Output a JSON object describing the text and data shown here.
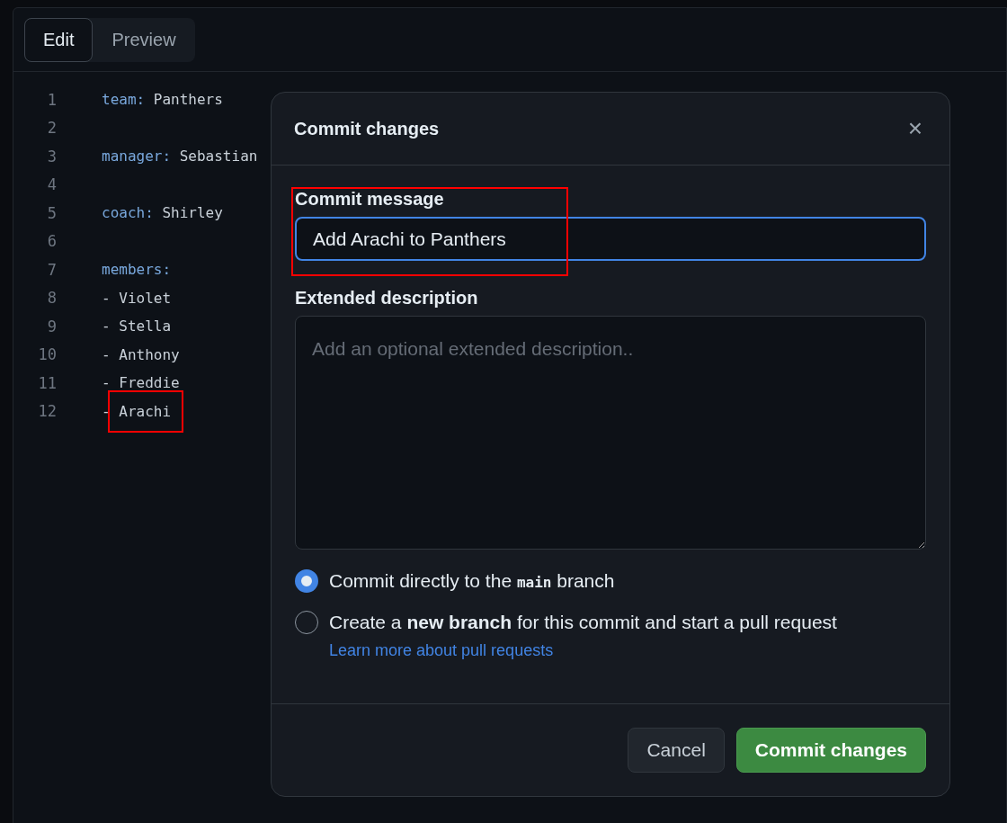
{
  "editor": {
    "tabs": [
      {
        "label": "Edit",
        "selected": true
      },
      {
        "label": "Preview",
        "selected": false
      }
    ],
    "lines": [
      {
        "number": "1",
        "kind": "pair",
        "key": "team:",
        "value": "Panthers",
        "highlighted": false
      },
      {
        "number": "2",
        "kind": "blank",
        "highlighted": false
      },
      {
        "number": "3",
        "kind": "pair",
        "key": "manager:",
        "value": "Sebastian",
        "highlighted": false
      },
      {
        "number": "4",
        "kind": "blank",
        "highlighted": false
      },
      {
        "number": "5",
        "kind": "pair",
        "key": "coach:",
        "value": "Shirley",
        "highlighted": false
      },
      {
        "number": "6",
        "kind": "blank",
        "highlighted": false
      },
      {
        "number": "7",
        "kind": "key",
        "key": "members:",
        "highlighted": false
      },
      {
        "number": "8",
        "kind": "item",
        "dash": "-",
        "value": "Violet",
        "highlighted": false
      },
      {
        "number": "9",
        "kind": "item",
        "dash": "-",
        "value": "Stella",
        "highlighted": false
      },
      {
        "number": "10",
        "kind": "item",
        "dash": "-",
        "value": "Anthony",
        "highlighted": false
      },
      {
        "number": "11",
        "kind": "item",
        "dash": "-",
        "value": "Freddie",
        "highlighted": false
      },
      {
        "number": "12",
        "kind": "item",
        "dash": "-",
        "value": "Arachi",
        "highlighted": true
      }
    ]
  },
  "dialog": {
    "title": "Commit changes",
    "close": "×",
    "commit_message": {
      "label": "Commit message",
      "value": "Add Arachi to Panthers",
      "focused": true,
      "highlighted": true
    },
    "extended_description": {
      "label": "Extended description",
      "placeholder": "Add an optional extended description.."
    },
    "options": [
      {
        "selected": true,
        "parts": [
          {
            "kind": "text",
            "text": "Commit directly to the "
          },
          {
            "kind": "code",
            "text": "main"
          },
          {
            "kind": "text",
            "text": " branch"
          }
        ]
      },
      {
        "selected": false,
        "parts": [
          {
            "kind": "text",
            "text": "Create a "
          },
          {
            "kind": "bold",
            "text": "new branch"
          },
          {
            "kind": "text",
            "text": " for this commit and start a pull request"
          }
        ],
        "link": "Learn more about pull requests"
      }
    ],
    "buttons": [
      {
        "label": "Cancel",
        "kind": "secondary"
      },
      {
        "label": "Commit changes",
        "kind": "primary"
      }
    ]
  }
}
